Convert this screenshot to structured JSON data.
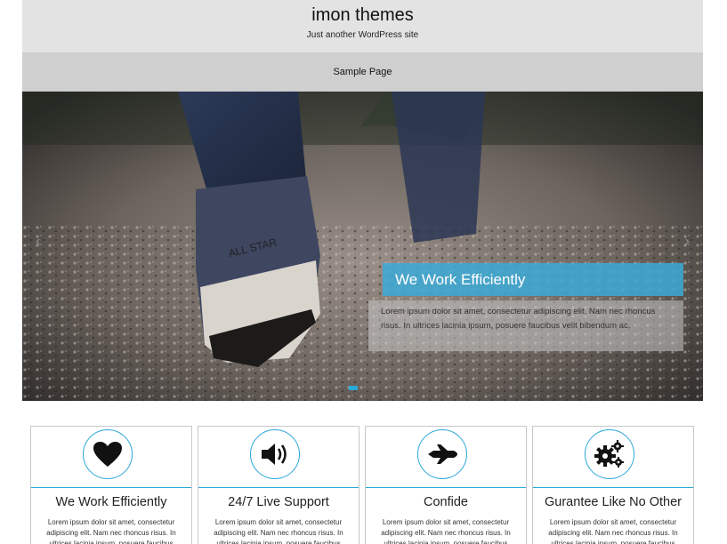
{
  "header": {
    "site_title": "imon themes",
    "tagline": "Just another WordPress site"
  },
  "nav": {
    "items": [
      {
        "label": "Sample Page"
      }
    ]
  },
  "slider": {
    "caption_title": "We Work Efficiently",
    "caption_text": "Lorem ipsum dolor sit amet, consectetur adipiscing elit. Nam nec rhoncus risus. In ultrices lacinia ipsum, posuere faucibus velit bibendum ac.",
    "prev_icon": "chevron-left-icon",
    "next_icon": "chevron-right-icon",
    "accent": "#2aa8d8"
  },
  "features": [
    {
      "title": "We Work Efficiently",
      "icon": "heart-icon",
      "text": "Lorem ipsum dolor sit amet, consectetur adipiscing elit. Nam nec rhoncus risus. In ultrices lacinia ipsum, posuere faucibus velit"
    },
    {
      "title": "24/7 Live Support",
      "icon": "speaker-icon",
      "text": "Lorem ipsum dolor sit amet, consectetur adipiscing elit. Nam nec rhoncus risus. In ultrices lacinia ipsum, posuere faucibus velit"
    },
    {
      "title": "Confide",
      "icon": "airplane-icon",
      "text": "Lorem ipsum dolor sit amet, consectetur adipiscing elit. Nam nec rhoncus risus. In ultrices lacinia ipsum, posuere faucibus velit"
    },
    {
      "title": "Gurantee Like No Other",
      "icon": "gears-icon",
      "text": "Lorem ipsum dolor sit amet, consectetur adipiscing elit. Nam nec rhoncus risus. In ultrices lacinia ipsum, posuere faucibus velit"
    }
  ]
}
